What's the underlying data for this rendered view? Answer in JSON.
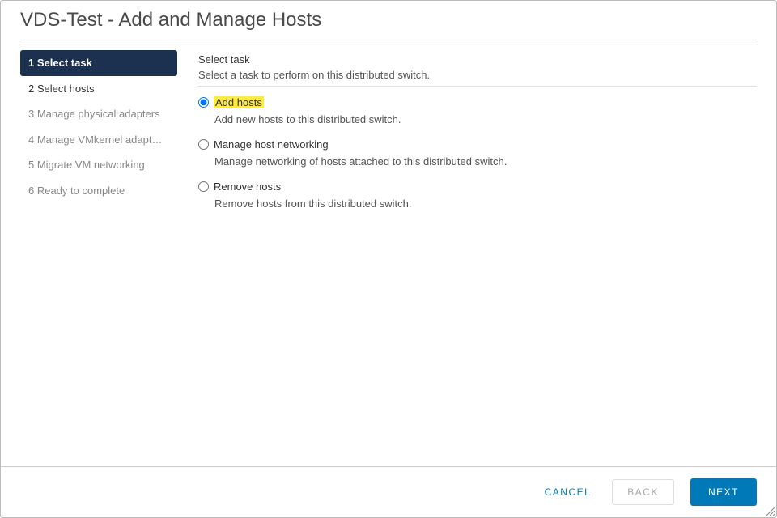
{
  "title": "VDS-Test - Add and Manage Hosts",
  "steps": [
    {
      "label": "1 Select task",
      "state": "current"
    },
    {
      "label": "2 Select hosts",
      "state": "available"
    },
    {
      "label": "3 Manage physical adapters",
      "state": "disabled"
    },
    {
      "label": "4 Manage VMkernel adapt…",
      "state": "disabled"
    },
    {
      "label": "5 Migrate VM networking",
      "state": "disabled"
    },
    {
      "label": "6 Ready to complete",
      "state": "disabled"
    }
  ],
  "main": {
    "heading": "Select task",
    "subheading": "Select a task to perform on this distributed switch.",
    "options": [
      {
        "id": "add-hosts",
        "label": "Add hosts",
        "desc": "Add new hosts to this distributed switch.",
        "selected": true,
        "highlight": true
      },
      {
        "id": "manage-host-networking",
        "label": "Manage host networking",
        "desc": "Manage networking of hosts attached to this distributed switch.",
        "selected": false,
        "highlight": false
      },
      {
        "id": "remove-hosts",
        "label": "Remove hosts",
        "desc": "Remove hosts from this distributed switch.",
        "selected": false,
        "highlight": false
      }
    ]
  },
  "footer": {
    "cancel": "CANCEL",
    "back": "BACK",
    "next": "NEXT",
    "back_disabled": true
  }
}
